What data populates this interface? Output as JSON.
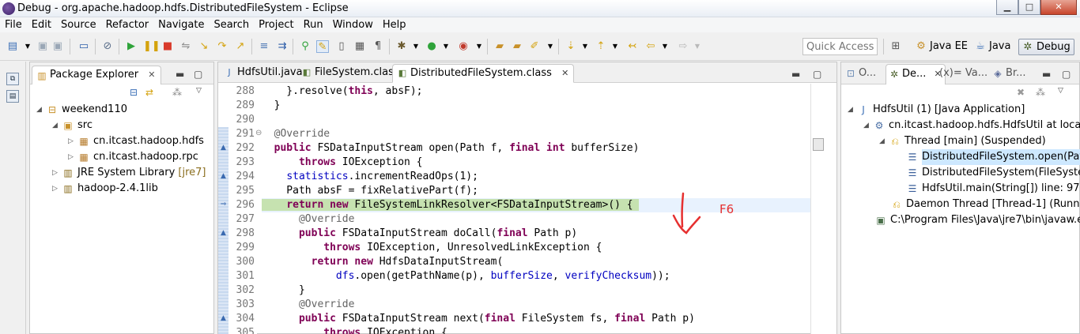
{
  "window": {
    "title": "Debug - org.apache.hadoop.hdfs.DistributedFileSystem - Eclipse",
    "minimize": "▁",
    "maximize": "□",
    "close": "✕"
  },
  "menu": [
    "File",
    "Edit",
    "Source",
    "Refactor",
    "Navigate",
    "Search",
    "Project",
    "Run",
    "Window",
    "Help"
  ],
  "toolbar": {
    "quick_access_placeholder": "Quick Access"
  },
  "perspectives": [
    {
      "label": "",
      "icon": "open-perspective-icon"
    },
    {
      "label": "Java EE",
      "icon": "java-ee-icon"
    },
    {
      "label": "Java",
      "icon": "java-icon"
    },
    {
      "label": "Debug",
      "icon": "debug-bug-icon"
    }
  ],
  "package_explorer": {
    "tab_label": "Package Explorer",
    "tree": [
      {
        "label": "weekend110",
        "deco": ""
      },
      {
        "label": "src",
        "deco": ""
      },
      {
        "label": "cn.itcast.hadoop.hdfs",
        "deco": ""
      },
      {
        "label": "cn.itcast.hadoop.rpc",
        "deco": ""
      },
      {
        "label": "JRE System Library",
        "deco": " [jre7]"
      },
      {
        "label": "hadoop-2.4.1lib",
        "deco": ""
      }
    ]
  },
  "editor": {
    "tabs": [
      "HdfsUtil.java",
      "FileSystem.class",
      "DistributedFileSystem.class"
    ],
    "line_numbers": [
      "288",
      "289",
      "290",
      "291",
      "292",
      "293",
      "294",
      "295",
      "296",
      "297",
      "298",
      "299",
      "300",
      "301",
      "302",
      "303",
      "304",
      "305"
    ],
    "annotation": "F6"
  },
  "debug": {
    "tabs": [
      "O...",
      "De...",
      "(x)= Va...",
      "Br..."
    ],
    "tree": [
      {
        "label": "HdfsUtil (1) [Java Application]"
      },
      {
        "label": "cn.itcast.hadoop.hdfs.HdfsUtil at localho"
      },
      {
        "label": "Thread [main] (Suspended)"
      },
      {
        "label": "DistributedFileSystem.open(Path,"
      },
      {
        "label": "DistributedFileSystem(FileSystem)."
      },
      {
        "label": "HdfsUtil.main(String[]) line: 97"
      },
      {
        "label": "Daemon Thread [Thread-1] (Running"
      },
      {
        "label": "C:\\Program Files\\Java\\jre7\\bin\\javaw.exe"
      }
    ]
  },
  "colors": {
    "current_line": "#c6e2b0",
    "keyword": "#7f0055",
    "annotation": "#646464",
    "field": "#0000c0",
    "marker": "#e63030"
  }
}
